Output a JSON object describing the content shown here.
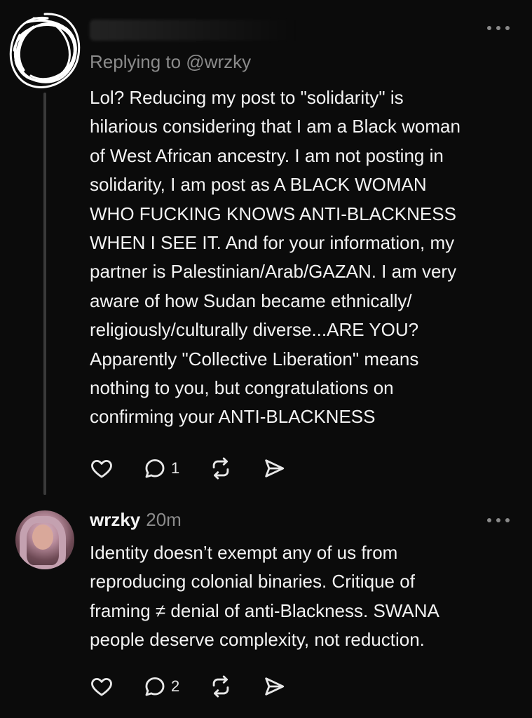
{
  "post1": {
    "replying_to": "Replying to @wrzky",
    "body": "Lol? Reducing my post to \"solidarity\" is\nhilarious considering that I am a Black woman\nof West African ancestry. I am not posting in\nsolidarity, I am post as A BLACK WOMAN\nWHO FUCKING KNOWS ANTI-BLACKNESS\nWHEN I SEE IT. And for your information, my\npartner is Palestinian/Arab/GAZAN. I am very\naware of how Sudan became ethnically/\nreligiously/culturally diverse...ARE YOU?\nApparently \"Collective Liberation\" means\nnothing to you, but congratulations on\nconfirming your ANTI-BLACKNESS",
    "reply_count": "1"
  },
  "post2": {
    "username": "wrzky",
    "time": "20m",
    "body": "Identity doesn’t exempt any of us from\nreproducing colonial binaries. Critique of\nframing ≠ denial of anti-Blackness. SWANA\npeople deserve complexity, not reduction.",
    "reply_count": "2"
  },
  "icons": [
    "like-icon",
    "reply-icon",
    "repost-icon",
    "share-icon",
    "more-icon"
  ]
}
